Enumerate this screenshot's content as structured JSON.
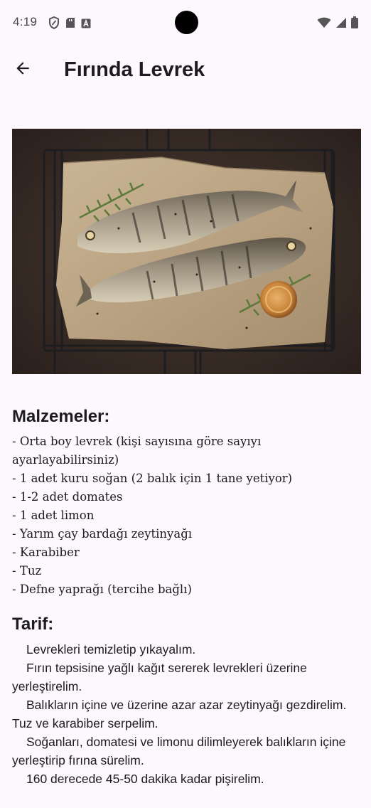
{
  "status_bar": {
    "time": "4:19"
  },
  "app_bar": {
    "title": "Fırında Levrek"
  },
  "hero": {
    "image_description_icon": "grilled-fish-photo"
  },
  "ingredients": {
    "heading": "Malzemeler:",
    "items": [
      "- Orta boy levrek (kişi sayısına göre sayıyı ayarlayabilirsiniz)",
      "- 1 adet kuru soğan (2 balık için 1 tane yetiyor)",
      "- 1-2 adet domates",
      "- 1 adet limon",
      "- Yarım çay bardağı zeytinyağı",
      "- Karabiber",
      "- Tuz",
      "- Defne yaprağı (tercihe bağlı)"
    ]
  },
  "recipe": {
    "heading": "Tarif:",
    "steps": [
      "Levrekleri temizletip yıkayalım.",
      "Fırın tepsisine yağlı kağıt sererek levrekleri üzerine yerleştirelim.",
      "Balıkların içine ve üzerine azar azar zeytinyağı gezdirelim. Tuz ve karabiber serpelim.",
      "Soğanları, domatesi ve limonu dilimleyerek balıkların içine yerleştirip fırına sürelim.",
      "160 derecede 45-50 dakika kadar pişirelim."
    ]
  }
}
